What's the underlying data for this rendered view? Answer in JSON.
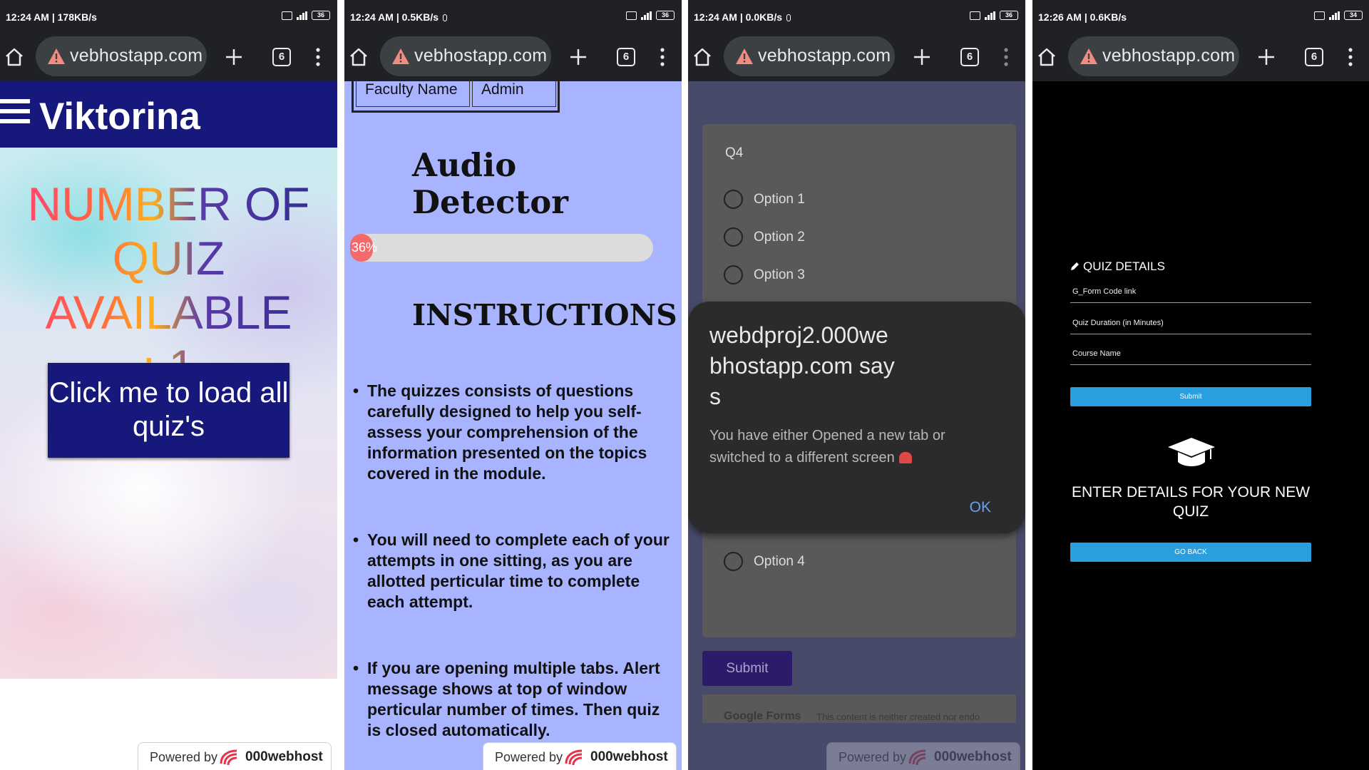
{
  "panels": [
    {
      "status": {
        "time": "12:24 AM | 178KB/s",
        "battery": "36"
      },
      "browser": {
        "url": "vebhostapp.com",
        "tab_count": "6"
      },
      "header": {
        "brand": "Viktorina"
      },
      "main": {
        "quiz_count_line1": "NUMBER OF",
        "quiz_count_line2": "QUIZ AVAILABLE",
        "quiz_count_line3": ": 1",
        "load_button": "Click me to load all quiz's"
      },
      "footer": {
        "powered_by": "Powered by",
        "host": "000webhost"
      }
    },
    {
      "status": {
        "time": "12:24 AM | 0.5KB/s",
        "battery": "36"
      },
      "browser": {
        "url": "vebhostapp.com",
        "tab_count": "6"
      },
      "table": {
        "col1": "Faculty Name",
        "col2": "Admin"
      },
      "title_line1": "Audio",
      "title_line2": "Detector",
      "progress": {
        "percent": 36,
        "label": "36%"
      },
      "instructions_title": "INSTRUCTIONS",
      "instructions": [
        "The quizzes consists of questions carefully designed to help you self-assess your comprehension of the information presented on the topics covered in the module.",
        "You will need to complete each of your attempts in one sitting, as you are allotted perticular time to complete each attempt.",
        "If you are opening multiple tabs. Alert message shows at top of window perticular number of times. Then quiz is closed automatically."
      ],
      "footer": {
        "powered_by": "Powered by",
        "host": "000webhost"
      }
    },
    {
      "status": {
        "time": "12:24 AM | 0.0KB/s",
        "battery": "36"
      },
      "browser": {
        "url": "vebhostapp.com",
        "tab_count": "6"
      },
      "form": {
        "question": "Q4",
        "options": [
          "Option 1",
          "Option 2",
          "Option 3",
          "Option 4"
        ],
        "submit": "Submit",
        "footer_brand": "Google Forms",
        "footer_text": "This content is neither created nor endo"
      },
      "dialog": {
        "title": "webdproj2.000webhostapp.com says",
        "message": "You have either Opened a new tab or switched to a different screen",
        "ok": "OK"
      },
      "footer": {
        "powered_by": "Powered by",
        "host": "000webhost"
      }
    },
    {
      "status": {
        "time": "12:26 AM | 0.6KB/s",
        "battery": "34"
      },
      "browser": {
        "url": "vebhostapp.com",
        "tab_count": "6"
      },
      "quiz_details": {
        "heading": "QUIZ DETAILS",
        "fields": [
          "G_Form Code link",
          "Quiz Duration (in Minutes)",
          "Course Name"
        ],
        "submit": "Submit",
        "message": "ENTER DETAILS FOR YOUR NEW QUIZ",
        "go_back": "GO BACK"
      }
    }
  ]
}
